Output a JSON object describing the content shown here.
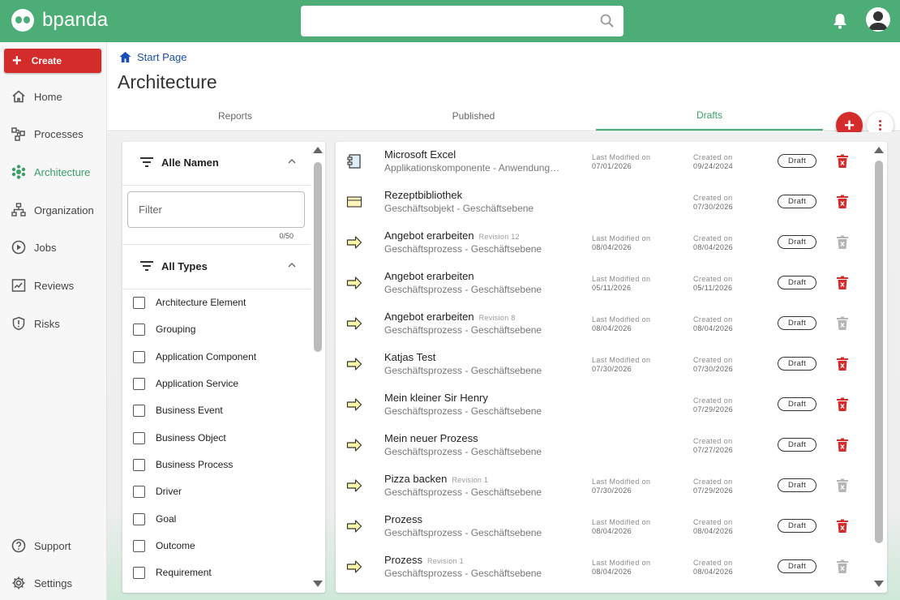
{
  "app": {
    "brand": "bpanda",
    "accent": "#4cae76",
    "danger": "#d42b2b"
  },
  "search": {
    "placeholder": "",
    "value": ""
  },
  "sidebar": {
    "create_label": "Create",
    "items": [
      {
        "label": "Home",
        "icon": "home-icon"
      },
      {
        "label": "Processes",
        "icon": "processes-icon"
      },
      {
        "label": "Architecture",
        "icon": "architecture-icon",
        "active": true
      },
      {
        "label": "Organization",
        "icon": "organization-icon"
      },
      {
        "label": "Jobs",
        "icon": "jobs-icon"
      },
      {
        "label": "Reviews",
        "icon": "reviews-icon"
      },
      {
        "label": "Risks",
        "icon": "risks-icon"
      }
    ],
    "bottom": [
      {
        "label": "Support",
        "icon": "help-icon"
      },
      {
        "label": "Settings",
        "icon": "gear-icon"
      }
    ]
  },
  "breadcrumb": {
    "label": "Start Page"
  },
  "page": {
    "title": "Architecture"
  },
  "tabs": [
    {
      "label": "Reports"
    },
    {
      "label": "Published"
    },
    {
      "label": "Drafts",
      "active": true
    }
  ],
  "filters": {
    "names": {
      "title": "Alle Namen",
      "input_placeholder": "Filter",
      "counter": "0/50"
    },
    "types": {
      "title": "All Types",
      "options": [
        "Architecture Element",
        "Grouping",
        "Application Component",
        "Application Service",
        "Business Event",
        "Business Object",
        "Business Process",
        "Driver",
        "Goal",
        "Outcome",
        "Requirement"
      ]
    }
  },
  "list": {
    "modified_label": "Last Modified on",
    "created_label": "Created on",
    "items": [
      {
        "title": "Microsoft Excel",
        "revision": "",
        "subtitle": "Applikationskomponente - Anwendungsebene",
        "icon": "application-component-icon",
        "modified": "07/01/2026",
        "created": "09/24/2024",
        "status": "Draft",
        "deletable": true
      },
      {
        "title": "Rezeptbibliothek",
        "revision": "",
        "subtitle": "Geschäftsobjekt - Geschäftsebene",
        "icon": "business-object-icon",
        "modified": "",
        "created": "07/30/2026",
        "status": "Draft",
        "deletable": true
      },
      {
        "title": "Angebot erarbeiten",
        "revision": "Revision 12",
        "subtitle": "Geschäftsprozess - Geschäftsebene",
        "icon": "business-process-icon",
        "modified": "08/04/2026",
        "created": "08/04/2026",
        "status": "Draft",
        "deletable": false
      },
      {
        "title": "Angebot erarbeiten",
        "revision": "",
        "subtitle": "Geschäftsprozess - Geschäftsebene",
        "icon": "business-process-icon",
        "modified": "05/11/2026",
        "created": "05/11/2026",
        "status": "Draft",
        "deletable": true
      },
      {
        "title": "Angebot erarbeiten",
        "revision": "Revision 8",
        "subtitle": "Geschäftsprozess - Geschäftsebene",
        "icon": "business-process-icon",
        "modified": "08/04/2026",
        "created": "08/04/2026",
        "status": "Draft",
        "deletable": false
      },
      {
        "title": "Katjas Test",
        "revision": "",
        "subtitle": "Geschäftsprozess - Geschäftsebene",
        "icon": "business-process-icon",
        "modified": "07/30/2026",
        "created": "07/30/2026",
        "status": "Draft",
        "deletable": true
      },
      {
        "title": "Mein kleiner Sir Henry",
        "revision": "",
        "subtitle": "Geschäftsprozess - Geschäftsebene",
        "icon": "business-process-icon",
        "modified": "",
        "created": "07/29/2026",
        "status": "Draft",
        "deletable": true
      },
      {
        "title": "Mein neuer Prozess",
        "revision": "",
        "subtitle": "Geschäftsprozess - Geschäftsebene",
        "icon": "business-process-icon",
        "modified": "",
        "created": "07/27/2026",
        "status": "Draft",
        "deletable": true
      },
      {
        "title": "Pizza backen",
        "revision": "Revision 1",
        "subtitle": "Geschäftsprozess - Geschäftsebene",
        "icon": "business-process-icon",
        "modified": "07/30/2026",
        "created": "07/29/2026",
        "status": "Draft",
        "deletable": false
      },
      {
        "title": "Prozess",
        "revision": "",
        "subtitle": "Geschäftsprozess - Geschäftsebene",
        "icon": "business-process-icon",
        "modified": "08/04/2026",
        "created": "08/04/2026",
        "status": "Draft",
        "deletable": true
      },
      {
        "title": "Prozess",
        "revision": "Revision 1",
        "subtitle": "Geschäftsprozess - Geschäftsebene",
        "icon": "business-process-icon",
        "modified": "08/04/2026",
        "created": "08/04/2026",
        "status": "Draft",
        "deletable": false
      }
    ]
  }
}
